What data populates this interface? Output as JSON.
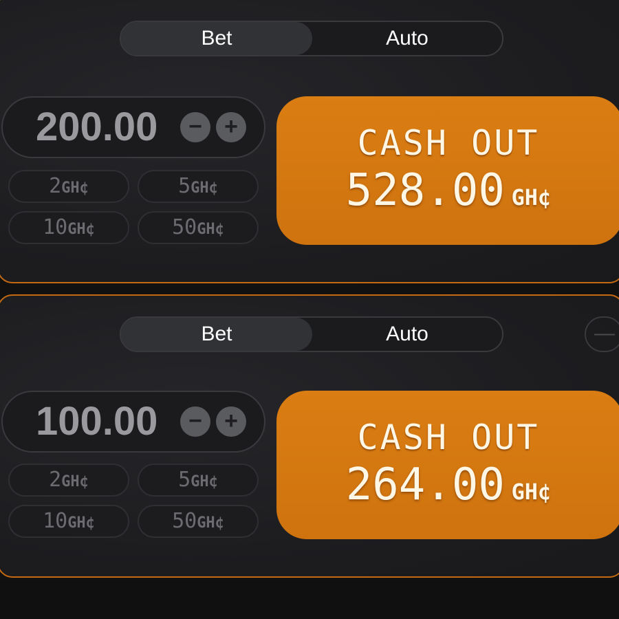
{
  "colors": {
    "accent": "#cf730f",
    "panel_border": "#c46a12",
    "background": "#1d1d20"
  },
  "currency": "GH¢",
  "panels": [
    {
      "tabs": {
        "bet": "Bet",
        "auto": "Auto"
      },
      "amount": "200.00",
      "minus_icon": "−",
      "plus_icon": "+",
      "chips": [
        {
          "num": "2",
          "cur": "GH¢"
        },
        {
          "num": "5",
          "cur": "GH¢"
        },
        {
          "num": "10",
          "cur": "GH¢"
        },
        {
          "num": "50",
          "cur": "GH¢"
        }
      ],
      "cashout": {
        "label": "CASH OUT",
        "amount": "528.00",
        "cur": "GH¢"
      }
    },
    {
      "tabs": {
        "bet": "Bet",
        "auto": "Auto"
      },
      "amount": "100.00",
      "minus_icon": "−",
      "plus_icon": "+",
      "side_icon": "—",
      "chips": [
        {
          "num": "2",
          "cur": "GH¢"
        },
        {
          "num": "5",
          "cur": "GH¢"
        },
        {
          "num": "10",
          "cur": "GH¢"
        },
        {
          "num": "50",
          "cur": "GH¢"
        }
      ],
      "cashout": {
        "label": "CASH OUT",
        "amount": "264.00",
        "cur": "GH¢"
      }
    }
  ]
}
